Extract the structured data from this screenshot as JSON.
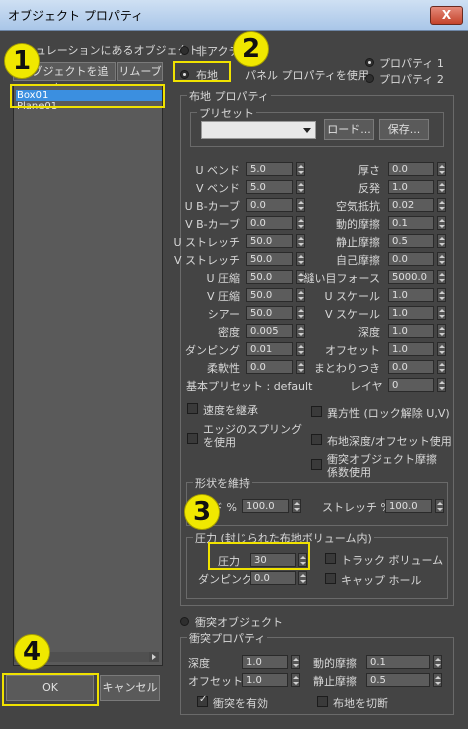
{
  "title": "オブジェクト プロパティ",
  "close_symbol": "X",
  "list_header": "シミュレーションにあるオブジェクト",
  "add_objects_button": "オブジェクトを追加...",
  "remove_button": "リムーブ",
  "objects": [
    "Box01",
    "Plane01"
  ],
  "ok_button": "OK",
  "cancel_button": "キャンセル",
  "type_radios": {
    "inactive": "非アクティブ",
    "cloth": "布地",
    "use_panel": "パネル プロパティを使用"
  },
  "property_radios": {
    "p1": "プロパティ 1",
    "p2": "プロパティ 2"
  },
  "cloth_props_group": "布地 プロパティ",
  "presets_group": "プリセット",
  "load_button": "ロード...",
  "save_button": "保存...",
  "left_params": [
    {
      "label": "U ベンド",
      "value": "5.0"
    },
    {
      "label": "V ベンド",
      "value": "5.0"
    },
    {
      "label": "U B-カーブ",
      "value": "0.0"
    },
    {
      "label": "V B-カーブ",
      "value": "0.0"
    },
    {
      "label": "U ストレッチ",
      "value": "50.0"
    },
    {
      "label": "V ストレッチ",
      "value": "50.0"
    },
    {
      "label": "U 圧縮",
      "value": "50.0"
    },
    {
      "label": "V 圧縮",
      "value": "50.0"
    },
    {
      "label": "シアー",
      "value": "50.0"
    },
    {
      "label": "密度",
      "value": "0.005"
    },
    {
      "label": "ダンピング",
      "value": "0.01"
    },
    {
      "label": "柔軟性",
      "value": "0.0"
    }
  ],
  "right_params": [
    {
      "label": "厚さ",
      "value": "0.0"
    },
    {
      "label": "反発",
      "value": "1.0"
    },
    {
      "label": "空気抵抗",
      "value": "0.02"
    },
    {
      "label": "動的摩擦",
      "value": "0.1"
    },
    {
      "label": "静止摩擦",
      "value": "0.5"
    },
    {
      "label": "自己摩擦",
      "value": "0.0"
    },
    {
      "label": "縫い目フォース",
      "value": "5000.0"
    },
    {
      "label": "U スケール",
      "value": "1.0"
    },
    {
      "label": "V スケール",
      "value": "1.0"
    },
    {
      "label": "深度",
      "value": "1.0"
    },
    {
      "label": "オフセット",
      "value": "1.0"
    },
    {
      "label": "まとわりつき",
      "value": "0.0"
    }
  ],
  "base_preset": "基本プリセット : default",
  "layer_label": "レイヤ",
  "layer_value": "0",
  "checks": {
    "use_rest": "速度を継承",
    "edge_springs_1": "エッジのスプリング",
    "edge_springs_2": "を使用",
    "anisotropic": "異方性 (ロック解除 U,V)",
    "cloth_depth": "布地深度/オフセット使用",
    "collision_friction_1": "衝突オブジェクト摩擦",
    "collision_friction_2": "係数使用"
  },
  "shape_group": "形状を維持",
  "shape_bend_label": "ベンド %",
  "shape_bend_value": "100.0",
  "shape_stretch_label": "ストレッチ %",
  "shape_stretch_value": "100.0",
  "pressure_group": "圧力 (封じられた布地ボリューム内)",
  "pressure_label": "圧力",
  "pressure_value": "30",
  "damping_label": "ダンピング",
  "damping_value": "0.0",
  "track_volume": "トラック ボリューム",
  "cap_holes": "キャップ ホール",
  "collision_radio": "衝突オブジェクト",
  "collision_props_group": "衝突プロパティ",
  "coll_depth_label": "深度",
  "coll_depth_value": "1.0",
  "coll_offset_label": "オフセット",
  "coll_offset_value": "1.0",
  "coll_dyn_label": "動的摩擦",
  "coll_dyn_value": "0.1",
  "coll_static_label": "静止摩擦",
  "coll_static_value": "0.5",
  "enable_collision": "衝突を有効",
  "cut_cloth": "布地を切断",
  "badges": [
    "1",
    "2",
    "3",
    "4"
  ]
}
